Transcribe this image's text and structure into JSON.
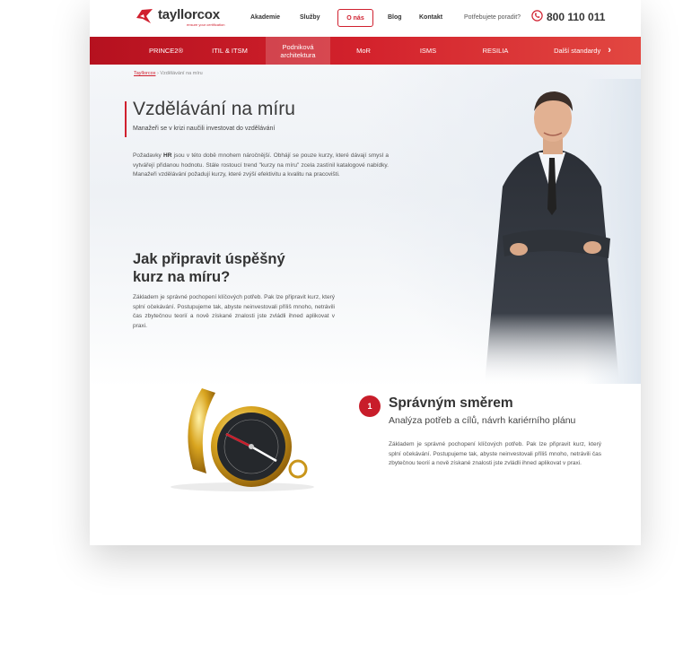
{
  "header": {
    "logo_name": "tayllorcox",
    "logo_tagline": "ensure your certification",
    "nav": [
      "Akademie",
      "Služby",
      "O nás",
      "Blog",
      "Kontakt"
    ],
    "help_text": "Potřebujete poradit?",
    "phone": "800 110 011"
  },
  "rednav": {
    "items": [
      "PRINCE2®",
      "ITIL & ITSM",
      "Podniková architektura",
      "MoR",
      "ISMS",
      "RESILIA",
      "Další standardy"
    ]
  },
  "breadcrumb": {
    "home": "Tayllorcox",
    "separator": "›",
    "current": "Vzdělávání na míru"
  },
  "hero": {
    "title": "Vzdělávání na míru",
    "subtitle": "Manažeři se v krizi naučili investovat do vzdělávání",
    "paragraph": "Požadavky HR jsou v této době mnohem náročnější. Obhájí se pouze kurzy, které dávají smysl a vytvářejí přidanou hodnotu. Stále rostoucí trend \"kurzy na míru\" zcela zastínil katalogové nabídky. Manažeři vzdělávání požadují kurzy, které zvýší efektivitu a kvalitu na pracovišti.",
    "highlight": "HR"
  },
  "section": {
    "title_line1": "Jak připravit úspěšný",
    "title_line2": "kurz na míru?",
    "paragraph": "Základem je správné pochopení klíčových potřeb. Pak lze připravit kurz, který splní očekávání. Postupujeme tak, abyste neinvestovali příliš mnoho, netrávili čas zbytečnou teorií a nově získané znalosti jste zvládli ihned aplikovat v praxi."
  },
  "step": {
    "number": "1",
    "title": "Správným směrem",
    "subtitle": "Analýza potřeb a cílů, návrh kariérního plánu",
    "paragraph": "Základem je správné pochopení klíčových potřeb. Pak lze připravit kurz, který splní očekávání. Postupujeme tak, abyste neinvestovali příliš mnoho, netrávili čas zbytečnou teorií a nově získané znalosti jste zvládli ihned aplikovat v praxi."
  },
  "colors": {
    "accent": "#d0202f",
    "nav_gradient_start": "#b5111f",
    "nav_gradient_end": "#e24741"
  },
  "icons": [
    "logo-mark-icon",
    "phone-icon",
    "chevron-right-icon"
  ]
}
